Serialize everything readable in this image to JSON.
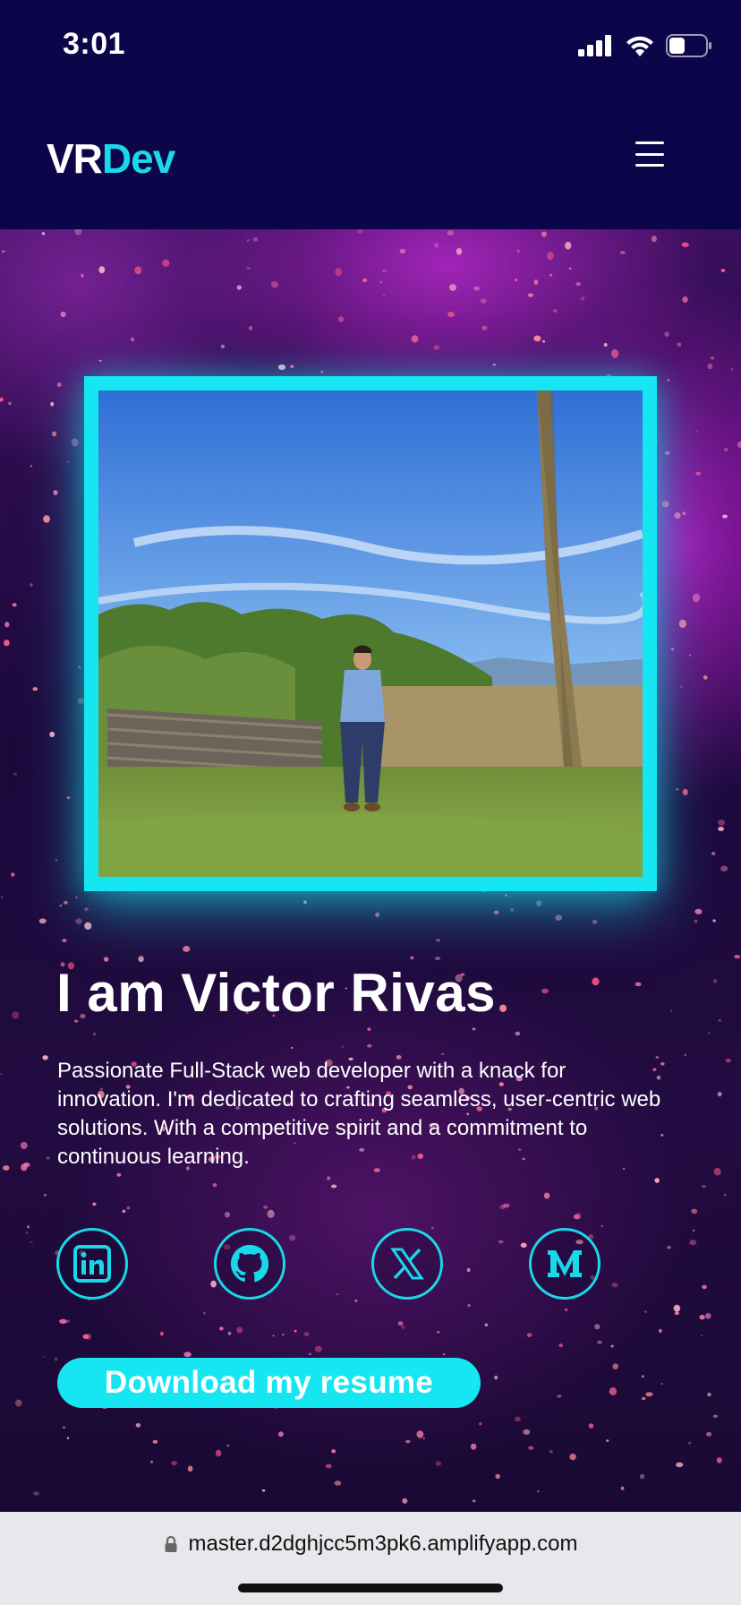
{
  "status_bar": {
    "time": "3:01",
    "icons": [
      "signal-icon",
      "wifi-icon",
      "battery-icon"
    ]
  },
  "header": {
    "logo_part1": "VR",
    "logo_part2": "Dev",
    "menu_icon": "hamburger-menu-icon"
  },
  "hero": {
    "title": "I am Victor Rivas",
    "description": "Passionate Full-Stack web developer with a knack for innovation. I'm dedicated to crafting seamless, user-centric web solutions. With a competitive spirit and a commitment to continuous learning.",
    "socials": [
      {
        "icon": "linkedin-icon"
      },
      {
        "icon": "github-icon"
      },
      {
        "icon": "x-icon"
      },
      {
        "icon": "medium-icon"
      }
    ],
    "resume_button": "Download my resume"
  },
  "browser": {
    "url": "master.d2dghjcc5m3pk6.amplifyapp.com"
  },
  "colors": {
    "accent": "#16e6f2",
    "background": "#0d054a",
    "url_bar": "#e8e8ec"
  }
}
